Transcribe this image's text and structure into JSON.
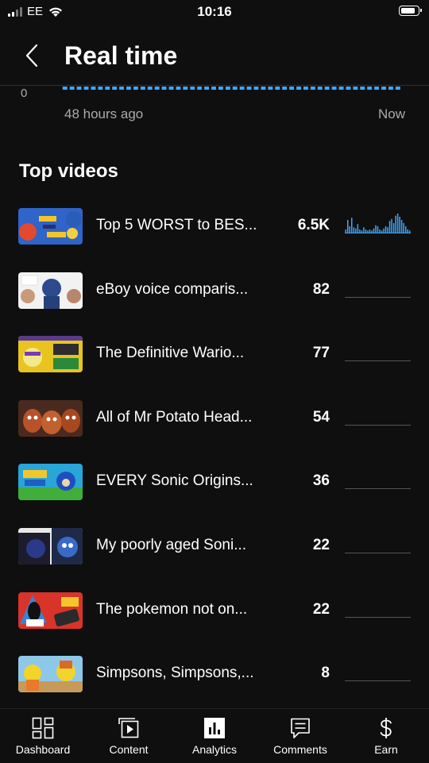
{
  "status_bar": {
    "carrier": "EE",
    "time": "10:16"
  },
  "header": {
    "title": "Real time",
    "back_icon": "chevron-left-icon"
  },
  "chart_data": {
    "type": "bar",
    "x_start_label": "48 hours ago",
    "x_end_label": "Now",
    "y_tick": "0",
    "bar_color": "#3ea6ff"
  },
  "section": {
    "title": "Top videos"
  },
  "videos": [
    {
      "title": "Top 5 WORST to BES...",
      "views": "6.5K",
      "spark": [
        3,
        12,
        6,
        14,
        5,
        4,
        8,
        3,
        2,
        5,
        3,
        2,
        3,
        2,
        4,
        7,
        6,
        3,
        2,
        4,
        6,
        5,
        11,
        13,
        9,
        16,
        18,
        15,
        12,
        9,
        6,
        3,
        2
      ]
    },
    {
      "title": "eBoy voice comparis...",
      "views": "82",
      "spark": []
    },
    {
      "title": "The Definitive Wario...",
      "views": "77",
      "spark": []
    },
    {
      "title": "All of Mr Potato Head...",
      "views": "54",
      "spark": []
    },
    {
      "title": "EVERY Sonic Origins...",
      "views": "36",
      "spark": []
    },
    {
      "title": "My poorly aged Soni...",
      "views": "22",
      "spark": []
    },
    {
      "title": "The pokemon not on...",
      "views": "22",
      "spark": []
    },
    {
      "title": "Simpsons, Simpsons,...",
      "views": "8",
      "spark": []
    }
  ],
  "nav": {
    "items": [
      {
        "label": "Dashboard",
        "icon": "dashboard-icon"
      },
      {
        "label": "Content",
        "icon": "content-icon"
      },
      {
        "label": "Analytics",
        "icon": "analytics-icon"
      },
      {
        "label": "Comments",
        "icon": "comments-icon"
      },
      {
        "label": "Earn",
        "icon": "earn-icon"
      }
    ],
    "active": "Analytics"
  },
  "colors": {
    "background": "#0f0f0f",
    "accent": "#3ea6ff",
    "muted_text": "#aaaaaa"
  }
}
